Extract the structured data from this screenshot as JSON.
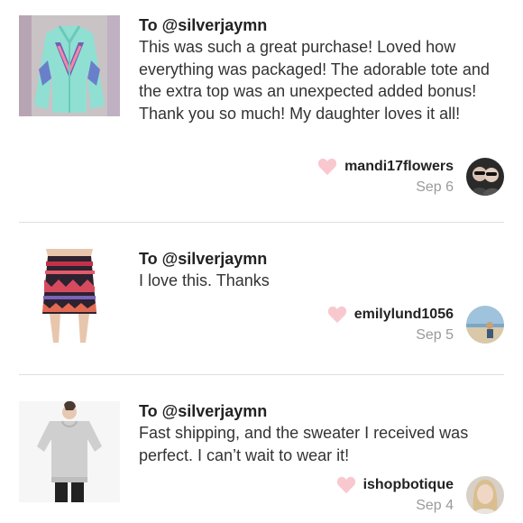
{
  "reviews": [
    {
      "to": "To @silverjaymn",
      "message": "This was such a great purchase! Loved how everything was packaged! The adorable tote and the extra top was an unexpected added bonus! Thank you so much! My daughter loves it all!",
      "username": "mandi17flowers",
      "date": "Sep 6",
      "thumb_icon": "mint-jacket-photo",
      "avatar_icon": "user-avatar-photo"
    },
    {
      "to": "To @silverjaymn",
      "message": "I love this. Thanks",
      "username": "emilylund1056",
      "date": "Sep 5",
      "thumb_icon": "tribal-skirt-photo",
      "avatar_icon": "user-avatar-photo"
    },
    {
      "to": "To @silverjaymn",
      "message": "Fast shipping, and the sweater I received was perfect. I can’t wait to wear it!",
      "username": "ishopbotique",
      "date": "Sep 4",
      "thumb_icon": "grey-sweater-photo",
      "avatar_icon": "user-avatar-photo"
    }
  ],
  "colors": {
    "heart": "#f9c8cf",
    "divider": "#dedede",
    "date": "#9a9a9a"
  }
}
